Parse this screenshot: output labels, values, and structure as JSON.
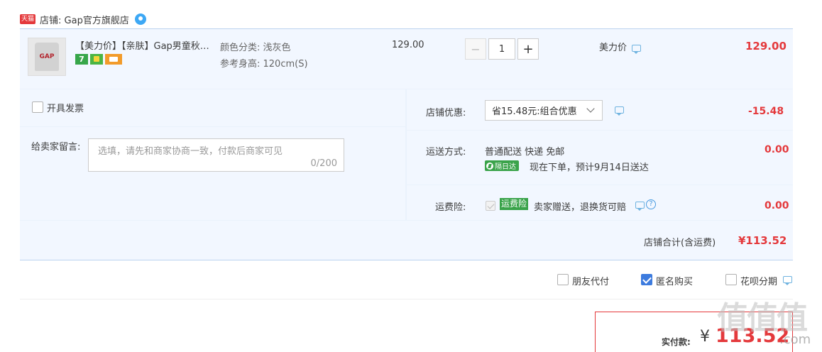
{
  "shop": {
    "badge": "天猫",
    "name": "店铺: Gap官方旗舰店"
  },
  "item": {
    "title": "【美力价】【亲肤】Gap男童秋…",
    "image_text": "GAP",
    "sku_color": "颜色分类: 浅灰色",
    "sku_height": "参考身高: 120cm(S)",
    "unit_price": "129.00",
    "quantity": "1",
    "minus": "−",
    "plus": "+",
    "promo_label": "美力价",
    "total": "129.00",
    "badge_7": "7"
  },
  "invoice": {
    "label": "开具发票"
  },
  "message": {
    "label": "给卖家留言:",
    "placeholder": "选填，请先和商家协商一致，付款后商家可见",
    "counter": "0/200"
  },
  "discount": {
    "label": "店铺优惠:",
    "selected": "省15.48元:组合优惠",
    "value": "-15.48"
  },
  "shipping": {
    "label": "运送方式:",
    "method": "普通配送 快递 免邮",
    "next_day_tag": "隔日达",
    "eta": "现在下单，预计9月14日送达",
    "value": "0.00"
  },
  "insurance": {
    "label": "运费险:",
    "tag": "运费险",
    "desc": "卖家赠送，退换货可赔",
    "help": "?",
    "value": "0.00"
  },
  "subtotal": {
    "label": "店铺合计(含运费)",
    "value": "¥113.52"
  },
  "options": {
    "friend_pay": "朋友代付",
    "anonymous": "匿名购买",
    "huabei": "花呗分期"
  },
  "payment": {
    "label": "实付款:",
    "currency": "¥",
    "value": "113.52"
  },
  "watermark": "值值值",
  "watermark_url": ".com",
  "colors": {
    "accent_red": "#e4393c",
    "row_bg": "#f2f7ff",
    "checkbox_blue": "#3d7bde",
    "insurance_green": "#3aa34a"
  }
}
